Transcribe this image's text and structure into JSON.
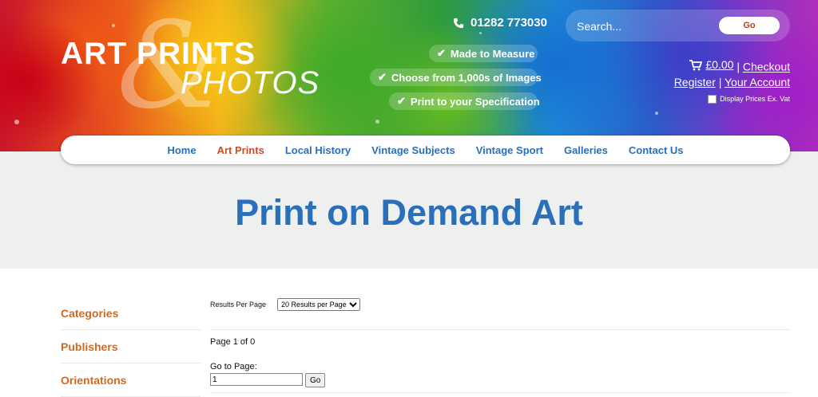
{
  "header": {
    "logo_line1": "ART PRINTS",
    "logo_line2": "PHOTOS",
    "logo_amp": "&",
    "phone": "01282 773030",
    "features": [
      "Made to Measure",
      "Choose from 1,000s of Images",
      "Print to your Specification"
    ],
    "search": {
      "placeholder": "Search...",
      "button": "Go"
    },
    "cart_total": "£0.00",
    "checkout": "Checkout",
    "register": "Register",
    "your_account": "Your Account",
    "vat_label": "Display Prices Ex. Vat",
    "separator": "|"
  },
  "nav": {
    "items": [
      "Home",
      "Art Prints",
      "Local History",
      "Vintage Subjects",
      "Vintage Sport",
      "Galleries",
      "Contact Us"
    ],
    "active": "Art Prints"
  },
  "hero": {
    "title": "Print on Demand Art"
  },
  "sidebar": {
    "items": [
      "Categories",
      "Publishers",
      "Orientations"
    ]
  },
  "results": {
    "per_page_label": "Results Per Page",
    "per_page_selected": "20 Results per Page",
    "page_info": "Page 1 of 0",
    "goto_label": "Go to Page:",
    "goto_value": "1",
    "goto_button": "Go"
  },
  "colors": {
    "brand_blue": "#2a6fba",
    "accent_orange": "#d2491f",
    "sidebar_orange": "#d2691e",
    "hero_bg": "#eef0f0"
  }
}
